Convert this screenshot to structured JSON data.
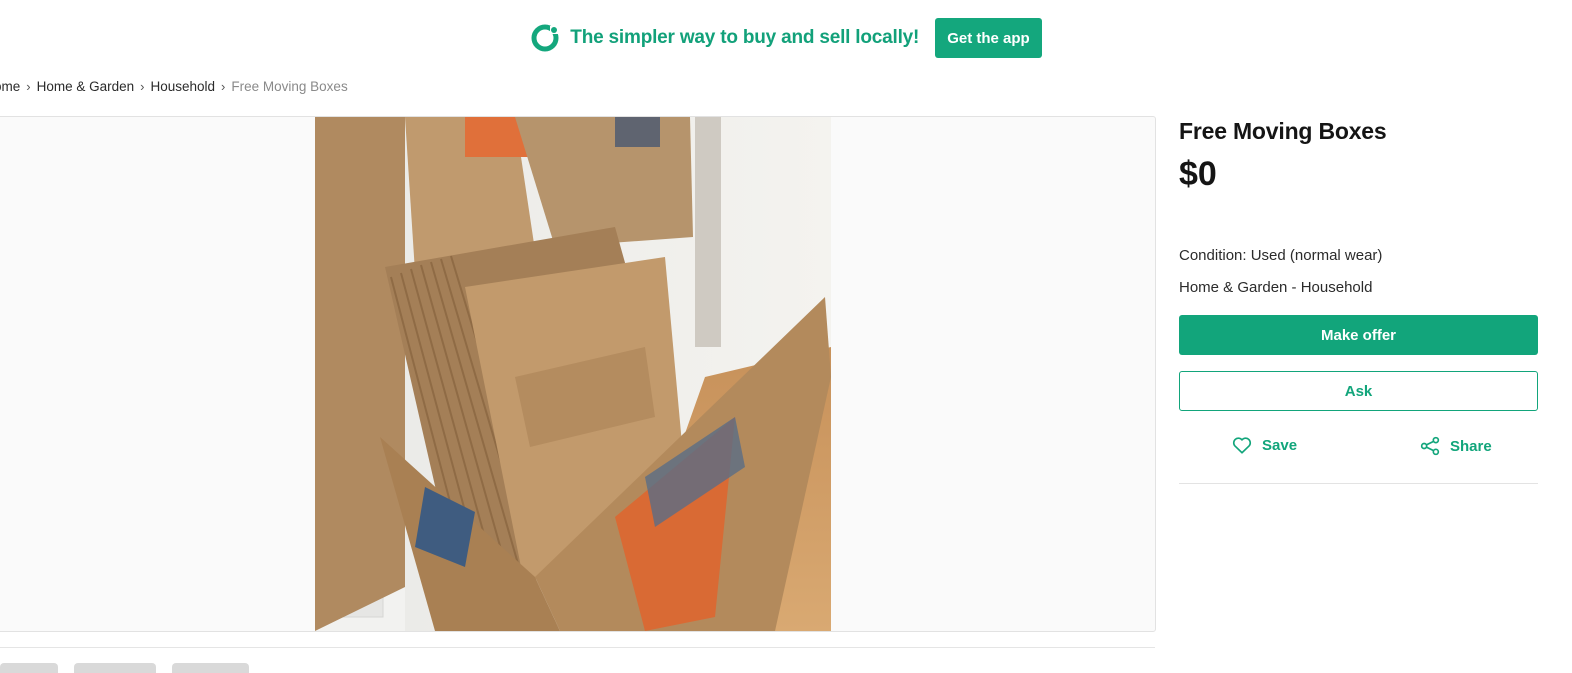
{
  "banner": {
    "tagline": "The simpler way to buy and sell locally!",
    "cta_label": "Get the app",
    "logo_icon": "offerup-logo-icon",
    "brand_color": "#14a77d"
  },
  "breadcrumb": {
    "items": [
      "ome",
      "Home & Garden",
      "Household"
    ],
    "current": "Free Moving Boxes",
    "separator": "›"
  },
  "gallery": {
    "photo_alt": "Stack of flattened cardboard moving boxes standing in a large cardboard box"
  },
  "listing": {
    "title": "Free Moving Boxes",
    "price": "$0",
    "condition": "Condition: Used (normal wear)",
    "category": "Home & Garden - Household",
    "make_offer_label": "Make offer",
    "ask_label": "Ask",
    "save_label": "Save",
    "share_label": "Share",
    "save_icon": "heart-icon",
    "share_icon": "share-icon"
  }
}
